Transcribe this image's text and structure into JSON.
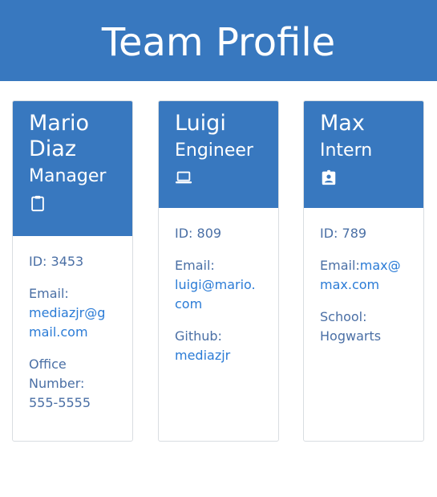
{
  "header": {
    "title": "Team Profile"
  },
  "cards": [
    {
      "name": "Mario Diaz",
      "role": "Manager",
      "icon": "clipboard-icon",
      "id_label": "ID: ",
      "id_value": "3453",
      "email_label": "Email:",
      "email_value": "mediazjr@gmail.com",
      "extra_label": "Office Number:",
      "extra_value": "555-5555"
    },
    {
      "name": "Luigi",
      "role": "Engineer",
      "icon": "laptop-icon",
      "id_label": "ID: ",
      "id_value": "809",
      "email_label": "Email:",
      "email_value": "luigi@mario.com",
      "extra_label": "Github:",
      "extra_value": "mediazjr"
    },
    {
      "name": "Max",
      "role": "Intern",
      "icon": "id-badge-icon",
      "id_label": "ID: ",
      "id_value": "789",
      "email_label": "Email:",
      "email_value": "max@max.com",
      "extra_label": "School:",
      "extra_value": "Hogwarts"
    }
  ],
  "colors": {
    "brand": "#3878bf",
    "link": "#2a7bd6",
    "text": "#4a6fa5"
  }
}
